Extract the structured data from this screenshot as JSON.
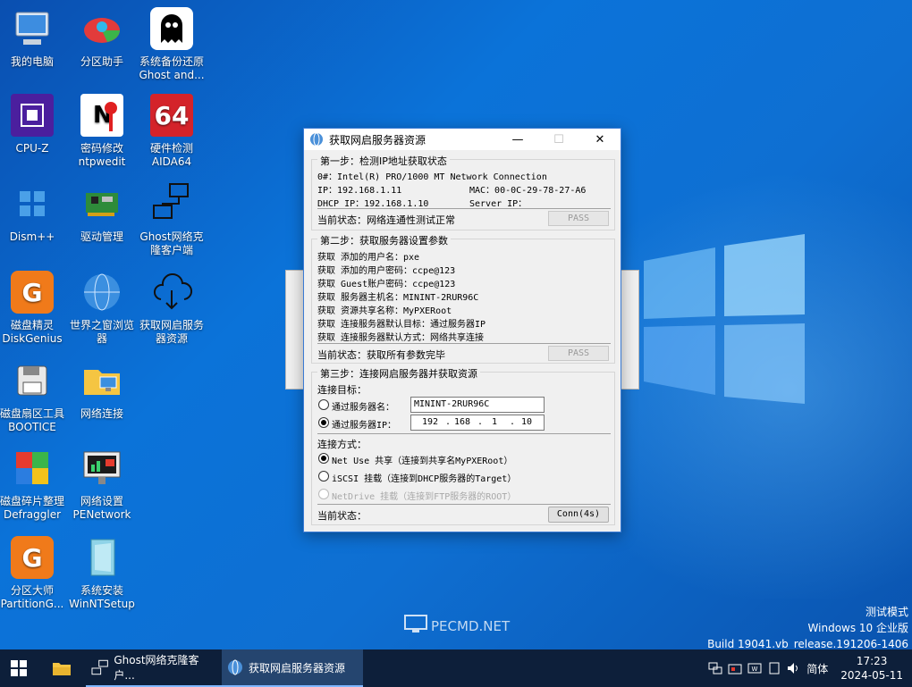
{
  "desktop": {
    "icons": [
      {
        "label": "我的电脑"
      },
      {
        "label": "分区助手"
      },
      {
        "label": "系统备份还原\nGhost and..."
      },
      {
        "label": "CPU-Z"
      },
      {
        "label": "密码修改\nntpwedit"
      },
      {
        "label": "硬件检测\nAIDA64"
      },
      {
        "label": "Dism++"
      },
      {
        "label": "驱动管理"
      },
      {
        "label": "Ghost网络克\n隆客户端"
      },
      {
        "label": "磁盘精灵\nDiskGenius"
      },
      {
        "label": "世界之窗浏览\n器"
      },
      {
        "label": "获取网启服务\n器资源"
      },
      {
        "label": "磁盘扇区工具\nBOOTICE"
      },
      {
        "label": "网络连接"
      },
      {
        "label": "磁盘碎片整理\nDefraggler"
      },
      {
        "label": "网络设置\nPENetwork"
      },
      {
        "label": "分区大师\nPartitionG..."
      },
      {
        "label": "系统安装\nWinNTSetup"
      }
    ],
    "aida_text": "64"
  },
  "window": {
    "title": "获取网启服务器资源",
    "step1": {
      "title": "第一步：检测IP地址获取状态",
      "nic": "0#：Intel(R) PRO/1000 MT Network Connection",
      "ip": "IP：192.168.1.11",
      "mac": "MAC：00-0C-29-78-27-A6",
      "dhcp": "DHCP IP：192.168.1.10",
      "server": "Server IP：",
      "status": "当前状态：网络连通性测试正常",
      "pass": "PASS"
    },
    "step2": {
      "title": "第二步：获取服务器设置参数",
      "lines": [
        "获取 添加的用户名：pxe",
        "获取 添加的用户密码：ccpe@123",
        "获取 Guest账户密码：ccpe@123",
        "获取 服务器主机名：MININT-2RUR96C",
        "获取 资源共享名称：MyPXERoot",
        "获取 连接服务器默认目标：通过服务器IP",
        "获取 连接服务器默认方式：网络共享连接"
      ],
      "status": "当前状态：获取所有参数完毕",
      "pass": "PASS"
    },
    "step3": {
      "title": "第三步：连接网启服务器并获取资源",
      "target_label": "连接目标：",
      "by_name_label": "通过服务器名：",
      "by_name_value": "MININT-2RUR96C",
      "by_ip_label": "通过服务器IP：",
      "ip_octets": [
        "192",
        "168",
        "1",
        "10"
      ],
      "method_label": "连接方式：",
      "methods": [
        "Net Use 共享（连接到共享名MyPXERoot）",
        "iSCSI 挂载（连接到DHCP服务器的Target）",
        "NetDrive 挂载（连接到FTP服务器的ROOT）"
      ],
      "status": "当前状态：",
      "conn_button": "Conn(4s)"
    }
  },
  "watermark": "PECMD.NET",
  "system": {
    "test_mode": "测试模式",
    "edition": "Windows 10 企业版",
    "build": "Build 19041.vb_release.191206-1406"
  },
  "taskbar": {
    "apps": [
      {
        "label": "Ghost网络克隆客户..."
      },
      {
        "label": "获取网启服务器资源"
      }
    ],
    "ime": "简体",
    "time": "17:23",
    "date": "2024-05-11"
  }
}
